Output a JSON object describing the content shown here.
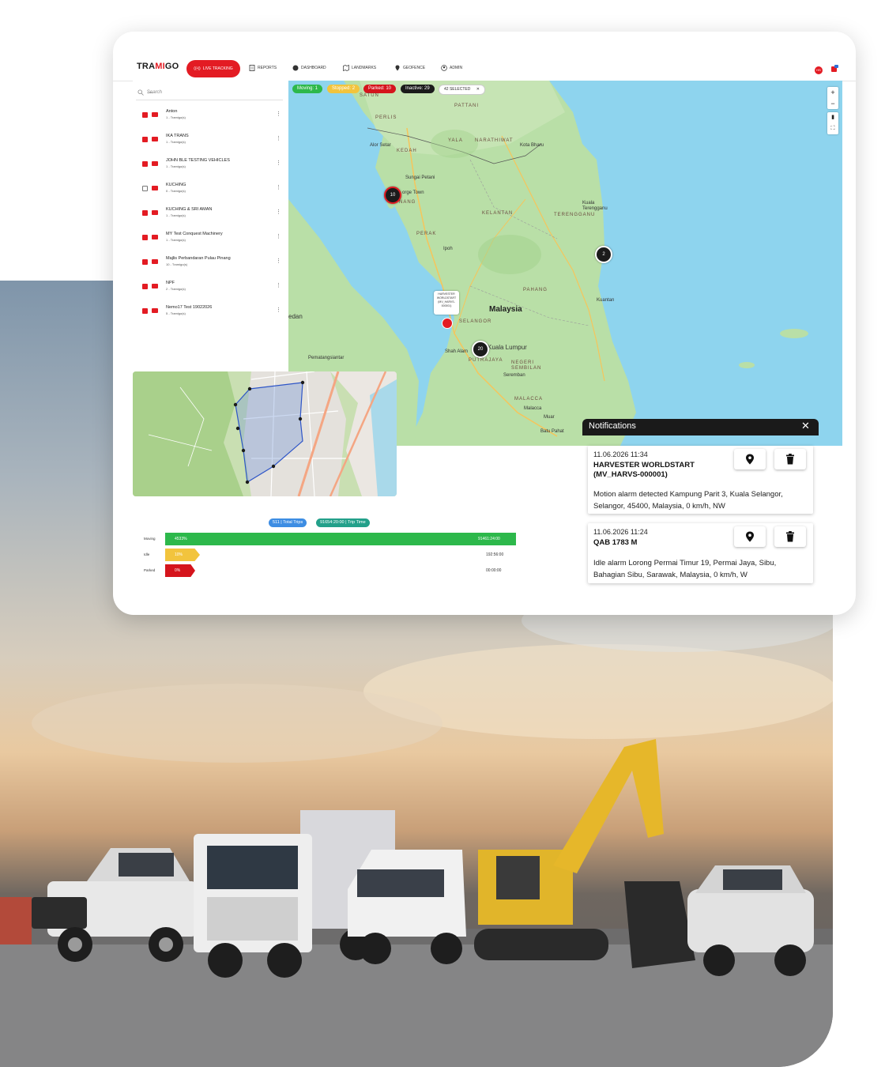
{
  "app": {
    "logo_pre": "TRA",
    "logo_mi": "MI",
    "logo_post": "GO",
    "nav": {
      "live": "LIVE TRACKING",
      "reports": "REPORTS",
      "dashboard": "DASHBOARD",
      "landmarks": "LANDMARKS",
      "geofence": "GEOFENCE",
      "admin": "ADMIN"
    },
    "user_initials": "HS"
  },
  "sidebar": {
    "search_placeholder": "Search",
    "groups": [
      {
        "name": "Anton",
        "count": "1 - Tramigo(s)",
        "checked": true
      },
      {
        "name": "IKA TRANS",
        "count": "1 - Tramigo(s)",
        "checked": true
      },
      {
        "name": "JOHN BLE TESTING VEHICLES",
        "count": "1 - Tramigo(s)",
        "checked": true
      },
      {
        "name": "KUCHING",
        "count": "0 - Tramigo(s)",
        "checked": false
      },
      {
        "name": "KUCHING & SRI AMAN",
        "count": "1 - Tramigo(s)",
        "checked": true
      },
      {
        "name": "MY Test Conquest Machinery",
        "count": "1 - Tramigo(s)",
        "checked": true
      },
      {
        "name": "Majlis Perbandaran Pulau Pinang",
        "count": "10 - Tramigo(s)",
        "checked": true
      },
      {
        "name": "NPF",
        "count": "2 - Tramigo(s)",
        "checked": true
      },
      {
        "name": "Nemo17 Test 19022026",
        "count": "5 - Tramigo(s)",
        "checked": true
      }
    ]
  },
  "map": {
    "status_chips": {
      "moving": "Moving: 1",
      "stopped": "Stopped: 2",
      "parked": "Parked: 10",
      "inactive": "Inactive: 29",
      "selected": "42 SELECTED"
    },
    "zoom_in": "+",
    "zoom_out": "−",
    "clusters": {
      "penang": "10",
      "terengganu": "2",
      "kl": "20"
    },
    "country": "Malaysia",
    "cities": {
      "pattani": "PATTANI",
      "yala": "YALA",
      "narathiwat": "NARATHIWAT",
      "kota_bharu": "Kota Bharu",
      "alor_setar": "Alor Setar",
      "kedah": "KEDAH",
      "sungai_petani": "Sungai Petani",
      "george_town": "orge Town",
      "kelantan": "KELANTAN",
      "terengganu": "TERENGGANU",
      "kuala_terengganu": "Kuala Terengganu",
      "perak": "PERAK",
      "ipoh": "Ipoh",
      "pahang": "PAHANG",
      "kuantan": "Kuantan",
      "selangor": "SELANGOR",
      "kuala_lumpur": "Kuala Lumpur",
      "shah_alam": "Shah Alam",
      "putrajaya": "PUTRAJAYA",
      "negeri_sembilan": "NEGERI SEMBILAN",
      "seremban": "Seremban",
      "malacca": "MALACCA",
      "malacca_city": "Malacca",
      "muar": "Muar",
      "batu_pahat": "Batu Pahat",
      "medan": "edan",
      "pematangsiantar": "Pematangsiantar",
      "satun": "SATUN",
      "perlis": "PERLIS",
      "penang_state": "NANG"
    },
    "popup": "HARVESTER WORLDSTART (MV_HARVS-000001)"
  },
  "trips": {
    "total_trips": "511 | Total Trips",
    "trip_time": "91654:20:00 | Trip Time",
    "rows": [
      {
        "label": "Moving",
        "pct": "4533%",
        "time": "91461:24:00",
        "color": "#2db84b"
      },
      {
        "label": "Idle",
        "pct": "10%",
        "time": "192:56:00",
        "color": "#f2c43d"
      },
      {
        "label": "Parked",
        "pct": "0%",
        "time": "00:00:00",
        "color": "#d5141c"
      }
    ]
  },
  "notifications": {
    "title": "Notifications",
    "items": [
      {
        "datetime": "11.06.2026 11:34",
        "vehicle": "HARVESTER WORLDSTART (MV_HARVS-000001)",
        "message": "Motion alarm detected Kampung Parit 3, Kuala Selangor, Selangor, 45400, Malaysia, 0 km/h, NW"
      },
      {
        "datetime": "11.06.2026 11:24",
        "vehicle": "QAB 1783 M",
        "message": "Idle alarm Lorong Permai Timur 19, Permai Jaya, Sibu, Bahagian Sibu, Sarawak, Malaysia, 0 km/h, W"
      }
    ]
  },
  "colors": {
    "brand": "#e31b23",
    "moving": "#2db84b",
    "stopped": "#f2c43d",
    "parked": "#d5141c",
    "inactive": "#1b1b1b",
    "sea": "#8ed4ee",
    "land": "#b9dfa7"
  }
}
